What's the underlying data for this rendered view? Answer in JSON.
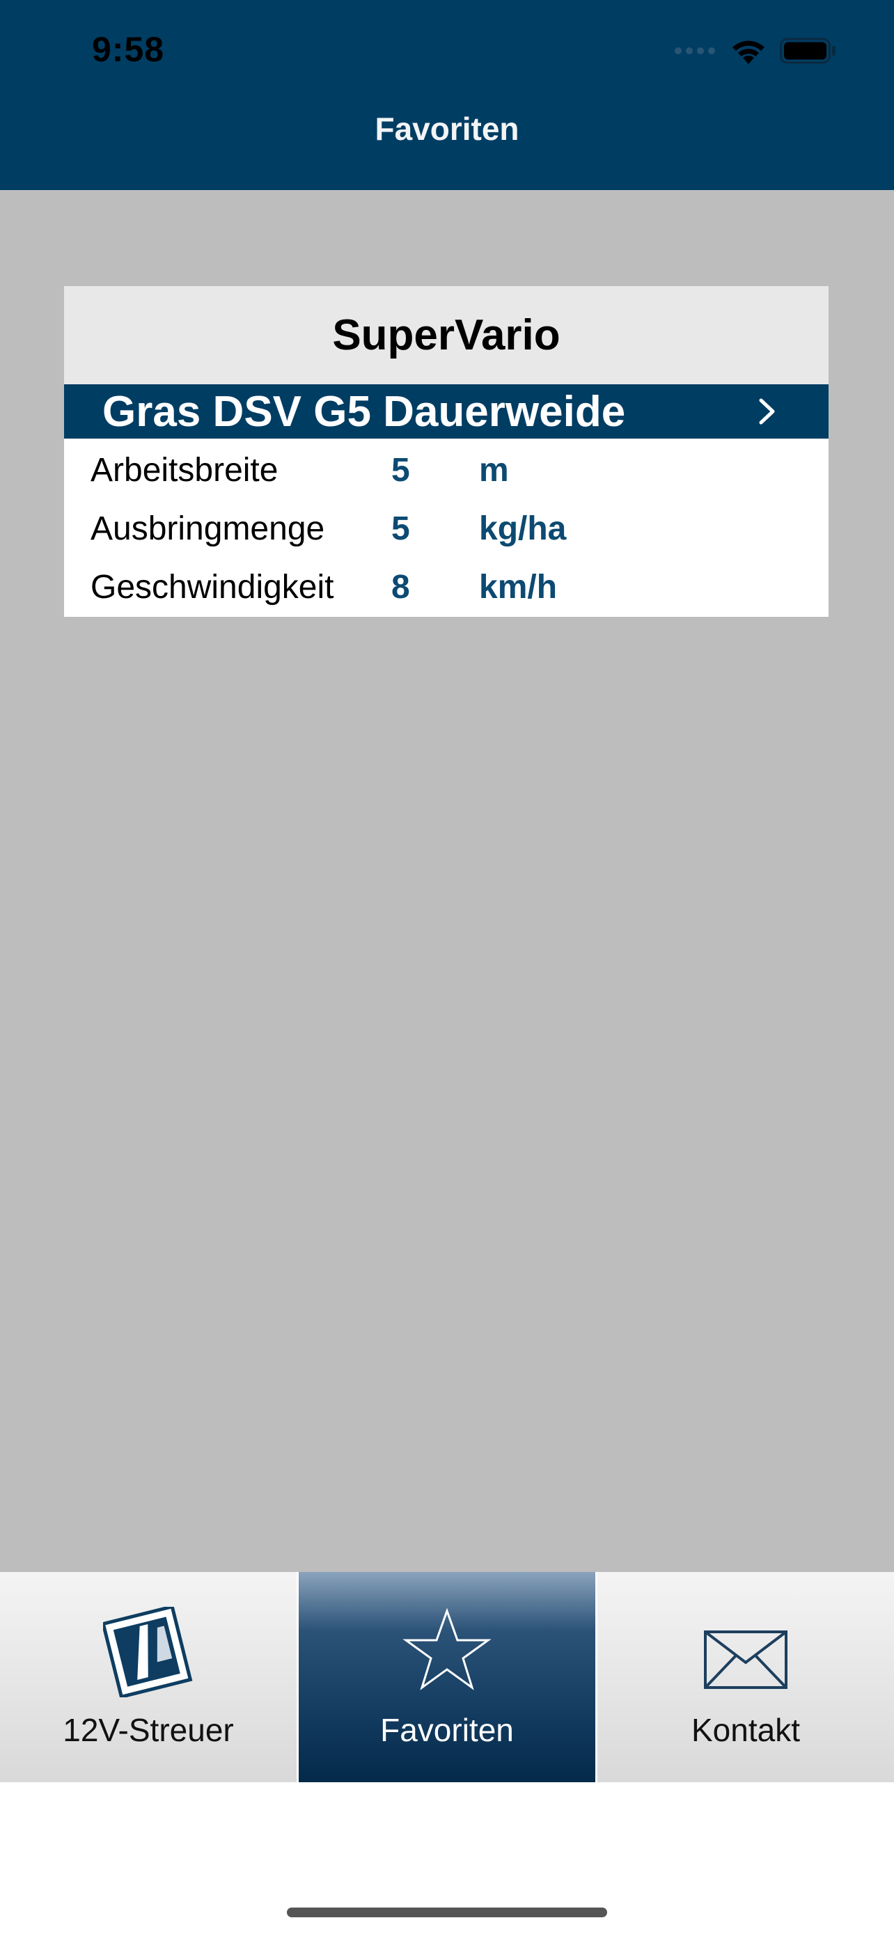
{
  "status_bar": {
    "time": "9:58"
  },
  "header": {
    "title": "Favoriten"
  },
  "favorite": {
    "device": "SuperVario",
    "seed": "Gras DSV G5 Dauerweide",
    "params": [
      {
        "label": "Arbeitsbreite",
        "value": "5",
        "unit": "m"
      },
      {
        "label": "Ausbringmenge",
        "value": "5",
        "unit": "kg/ha"
      },
      {
        "label": "Geschwindigkeit",
        "value": "8",
        "unit": "km/h"
      }
    ]
  },
  "tabs": [
    {
      "label": "12V-Streuer",
      "icon": "spreader-icon"
    },
    {
      "label": "Favoriten",
      "icon": "star-icon",
      "selected": true
    },
    {
      "label": "Kontakt",
      "icon": "mail-icon"
    }
  ],
  "colors": {
    "brand": "#003d63",
    "value": "#0c4a72",
    "background": "#bdbdbd"
  }
}
